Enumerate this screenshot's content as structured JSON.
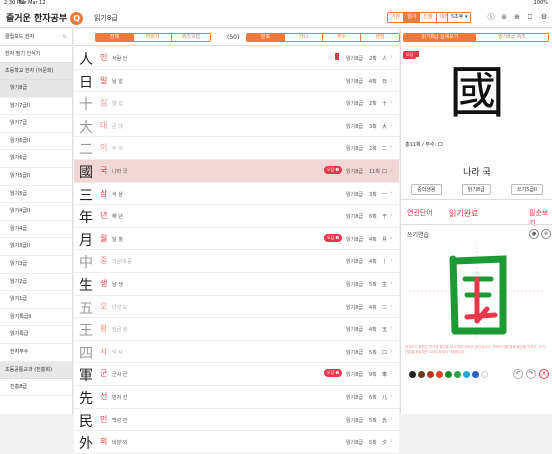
{
  "status": {
    "time": "2:30 PM",
    "date": "Tue Mar 12",
    "battery": "100%"
  },
  "header": {
    "logo_text": "즐거운 한자공부",
    "logo_q": "Q",
    "title": "읽기8급",
    "mode_tabs": [
      "기본",
      "읽기",
      "진출",
      "대리"
    ],
    "mode_selected": 1,
    "level_pill": "5초후 ▾",
    "icons": [
      "level-icon",
      "sort-icon",
      "menu-icon",
      "bookmark-icon",
      "gear-icon"
    ]
  },
  "sidebar": {
    "top": [
      {
        "label": "클립보드 한자"
      },
      {
        "label": "한자 필기 인식기"
      }
    ],
    "section1": "초등학교 한자 (어문회)",
    "items1": [
      "읽기8급",
      "읽기7급II",
      "읽기7급",
      "읽기6급II",
      "읽기6급",
      "읽기5급II",
      "읽기5급",
      "읽기4급II",
      "읽기4급",
      "읽기3급II",
      "읽기3급",
      "읽기2급",
      "읽기1급",
      "읽기특급II",
      "읽기특급",
      "한자부수"
    ],
    "section2": "초등공통교과 (진흥회)",
    "items2": [
      "진흥8급"
    ],
    "selected": 0
  },
  "filters": {
    "left": [
      "전체",
      "미읽기",
      "퀴즈오답"
    ],
    "left_selected": 0,
    "count": "(50)",
    "right": [
      "번호",
      "가나",
      "부수",
      "랜덤"
    ],
    "right_selected": 0
  },
  "rows": [
    {
      "han": "人",
      "reading": "인",
      "meaning": "사람 인",
      "level": "읽기8급",
      "strokes": "2획",
      "radical": "人",
      "bookmark": true,
      "badge": "",
      "faded": false
    },
    {
      "han": "日",
      "reading": "일",
      "meaning": "날 일",
      "level": "읽기8급",
      "strokes": "4획",
      "radical": "日",
      "bookmark": false,
      "badge": "",
      "faded": false
    },
    {
      "han": "十",
      "reading": "십",
      "meaning": "열 십",
      "level": "읽기8급",
      "strokes": "2획",
      "radical": "十",
      "bookmark": false,
      "badge": "",
      "faded": true
    },
    {
      "han": "大",
      "reading": "대",
      "meaning": "큰 대",
      "level": "읽기8급",
      "strokes": "3획",
      "radical": "大",
      "bookmark": false,
      "badge": "",
      "faded": true
    },
    {
      "han": "二",
      "reading": "이",
      "meaning": "두 이",
      "level": "읽기8급",
      "strokes": "2획",
      "radical": "二",
      "bookmark": false,
      "badge": "",
      "faded": true
    },
    {
      "han": "國",
      "reading": "국",
      "meaning": "나라 국",
      "level": "읽기8급",
      "strokes": "11획",
      "radical": "口",
      "bookmark": false,
      "badge": "오답 ➋",
      "faded": false
    },
    {
      "han": "三",
      "reading": "삼",
      "meaning": "석 삼",
      "level": "읽기8급",
      "strokes": "3획",
      "radical": "一",
      "bookmark": false,
      "badge": "",
      "faded": false
    },
    {
      "han": "年",
      "reading": "년",
      "meaning": "해 년",
      "level": "읽기8급",
      "strokes": "6획",
      "radical": "干",
      "bookmark": false,
      "badge": "",
      "faded": false
    },
    {
      "han": "月",
      "reading": "월",
      "meaning": "달 월",
      "level": "읽기8급",
      "strokes": "4획",
      "radical": "月",
      "bookmark": false,
      "badge": "오답 ➋",
      "faded": false
    },
    {
      "han": "中",
      "reading": "중",
      "meaning": "가운데 중",
      "level": "읽기8급",
      "strokes": "4획",
      "radical": "丨",
      "bookmark": false,
      "badge": "",
      "faded": true
    },
    {
      "han": "生",
      "reading": "생",
      "meaning": "날 생",
      "level": "읽기8급",
      "strokes": "5획",
      "radical": "生",
      "bookmark": false,
      "badge": "",
      "faded": false
    },
    {
      "han": "五",
      "reading": "오",
      "meaning": "다섯 오",
      "level": "읽기8급",
      "strokes": "4획",
      "radical": "二",
      "bookmark": false,
      "badge": "",
      "faded": true
    },
    {
      "han": "王",
      "reading": "왕",
      "meaning": "임금 왕",
      "level": "읽기8급",
      "strokes": "4획",
      "radical": "玉",
      "bookmark": false,
      "badge": "",
      "faded": true
    },
    {
      "han": "四",
      "reading": "사",
      "meaning": "넉 사",
      "level": "읽기8급",
      "strokes": "5획",
      "radical": "口",
      "bookmark": false,
      "badge": "",
      "faded": true
    },
    {
      "han": "軍",
      "reading": "군",
      "meaning": "군사 군",
      "level": "읽기8급",
      "strokes": "9획",
      "radical": "車",
      "bookmark": false,
      "badge": "오답 ➋",
      "faded": false
    },
    {
      "han": "先",
      "reading": "선",
      "meaning": "먼저 선",
      "level": "읽기8급",
      "strokes": "6획",
      "radical": "儿",
      "bookmark": false,
      "badge": "",
      "faded": false
    },
    {
      "han": "民",
      "reading": "민",
      "meaning": "백성 민",
      "level": "읽기8급",
      "strokes": "5획",
      "radical": "氏",
      "bookmark": false,
      "badge": "",
      "faded": false
    },
    {
      "han": "外",
      "reading": "외",
      "meaning": "바깥 외",
      "level": "읽기8급",
      "strokes": "5획",
      "radical": "夕",
      "bookmark": false,
      "badge": "",
      "faded": false
    }
  ],
  "detail": {
    "tabs": [
      "읽기8급 상세보기",
      "읽기8급 퀴즈"
    ],
    "tab_selected": 0,
    "char": "國",
    "bookmark_badge": "오답",
    "stroke_info": "총11획 / 부수: 口",
    "meaning": "나라 국",
    "chips": [
      "중학생용",
      "읽기8급",
      "쓰기5급II"
    ],
    "actions": [
      "연관단어",
      "읽기완료",
      "필순보기"
    ],
    "practice_label": "쓰기연습",
    "practice_char": "国",
    "note": "한자쓰기 화면은 한자의 필순을 보고 따라 써보는 공간입니다. 따라쓰기를 통해 필순을 익히고, 쓰기 연습을 완료하면 오답노트에서 삭제됩니다.",
    "palette": [
      "#222222",
      "#6b3a1f",
      "#b23a22",
      "#e0402a",
      "#1e8a2e",
      "#2aa54a",
      "#1faad8",
      "#2a5fb8",
      "#ffffff"
    ]
  },
  "colors": {
    "accent": "#f07a3c",
    "red": "#e8374b",
    "selected_row": "#f1d6d6"
  }
}
